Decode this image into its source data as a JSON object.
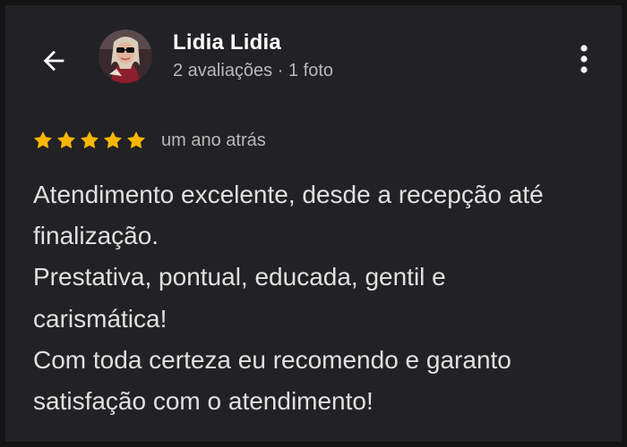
{
  "colors": {
    "background": "#222225",
    "star": "#f9b700",
    "text_primary": "#ffffff",
    "text_secondary": "#b9b9b9"
  },
  "header": {
    "back_icon": "arrow-left-icon",
    "menu_icon": "more-vert-icon"
  },
  "reviewer": {
    "name": "Lidia Lidia",
    "meta": "2 avaliações · 1 foto"
  },
  "review": {
    "rating": 5,
    "rating_max": 5,
    "date": "um ano atrás",
    "lines": [
      "Atendimento excelente, desde a recepção até",
      "finalização.",
      "Prestativa, pontual, educada, gentil e",
      "carismática!",
      "Com toda certeza eu recomendo e garanto",
      "satisfação com o atendimento!"
    ]
  }
}
